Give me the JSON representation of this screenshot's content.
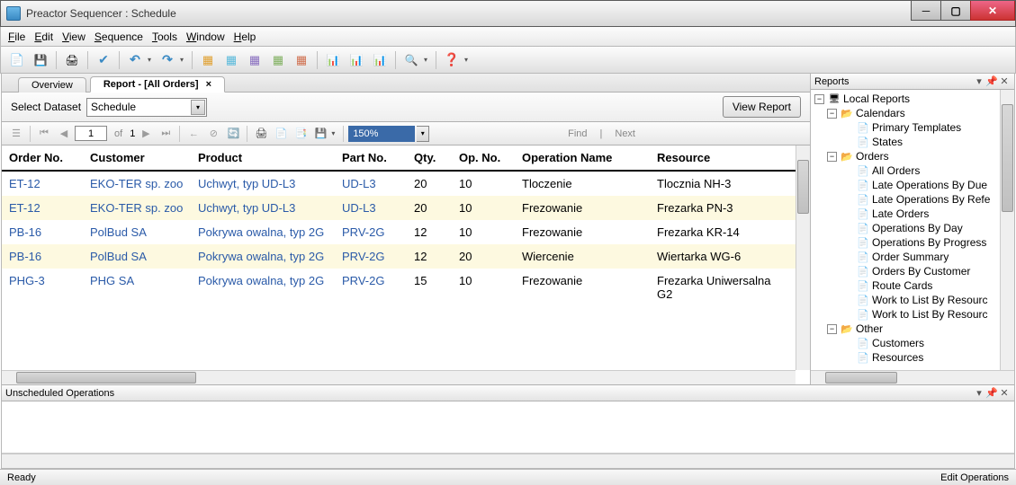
{
  "window": {
    "title": "Preactor Sequencer : Schedule"
  },
  "menu": {
    "file": "File",
    "edit": "Edit",
    "view": "View",
    "sequence": "Sequence",
    "tools": "Tools",
    "window": "Window",
    "help": "Help"
  },
  "tabs": {
    "overview": "Overview",
    "report": "Report - [All Orders]"
  },
  "dataset": {
    "label": "Select Dataset",
    "value": "Schedule",
    "viewbtn": "View Report"
  },
  "rtoolbar": {
    "page": "1",
    "of": "of",
    "total": "1",
    "zoom": "150%",
    "find": "Find",
    "next": "Next"
  },
  "table": {
    "headers": {
      "order": "Order No.",
      "customer": "Customer",
      "product": "Product",
      "part": "Part No.",
      "qty": "Qty.",
      "op": "Op. No.",
      "opname": "Operation Name",
      "resource": "Resource"
    },
    "rows": [
      {
        "order": "ET-12",
        "customer": "EKO-TER sp. zoo",
        "product": "Uchwyt, typ UD-L3",
        "part": "UD-L3",
        "qty": "20",
        "op": "10",
        "opname": "Tloczenie",
        "resource": "Tlocznia NH-3"
      },
      {
        "order": "ET-12",
        "customer": "EKO-TER sp. zoo",
        "product": "Uchwyt, typ UD-L3",
        "part": "UD-L3",
        "qty": "20",
        "op": "10",
        "opname": "Frezowanie",
        "resource": "Frezarka PN-3"
      },
      {
        "order": "PB-16",
        "customer": "PolBud SA",
        "product": "Pokrywa owalna, typ 2G",
        "part": "PRV-2G",
        "qty": "12",
        "op": "10",
        "opname": "Frezowanie",
        "resource": "Frezarka KR-14"
      },
      {
        "order": "PB-16",
        "customer": "PolBud SA",
        "product": "Pokrywa owalna, typ 2G",
        "part": "PRV-2G",
        "qty": "12",
        "op": "20",
        "opname": "Wiercenie",
        "resource": "Wiertarka WG-6"
      },
      {
        "order": "PHG-3",
        "customer": "PHG SA",
        "product": "Pokrywa owalna, typ 2G",
        "part": "PRV-2G",
        "qty": "15",
        "op": "10",
        "opname": "Frezowanie",
        "resource": "Frezarka Uniwersalna G2"
      }
    ]
  },
  "reportsPanel": {
    "title": "Reports",
    "root": "Local Reports",
    "calendars": "Calendars",
    "primaryTemplates": "Primary Templates",
    "states": "States",
    "orders": "Orders",
    "orderItems": [
      "All Orders",
      "Late Operations By Due",
      "Late Operations By Refe",
      "Late Orders",
      "Operations By Day",
      "Operations By Progress",
      "Order Summary",
      "Orders By Customer",
      "Route Cards",
      "Work to List By Resourc",
      "Work to List By Resourc"
    ],
    "other": "Other",
    "customers": "Customers",
    "resources": "Resources"
  },
  "unscheduled": {
    "title": "Unscheduled Operations"
  },
  "status": {
    "ready": "Ready",
    "right": "Edit Operations"
  }
}
